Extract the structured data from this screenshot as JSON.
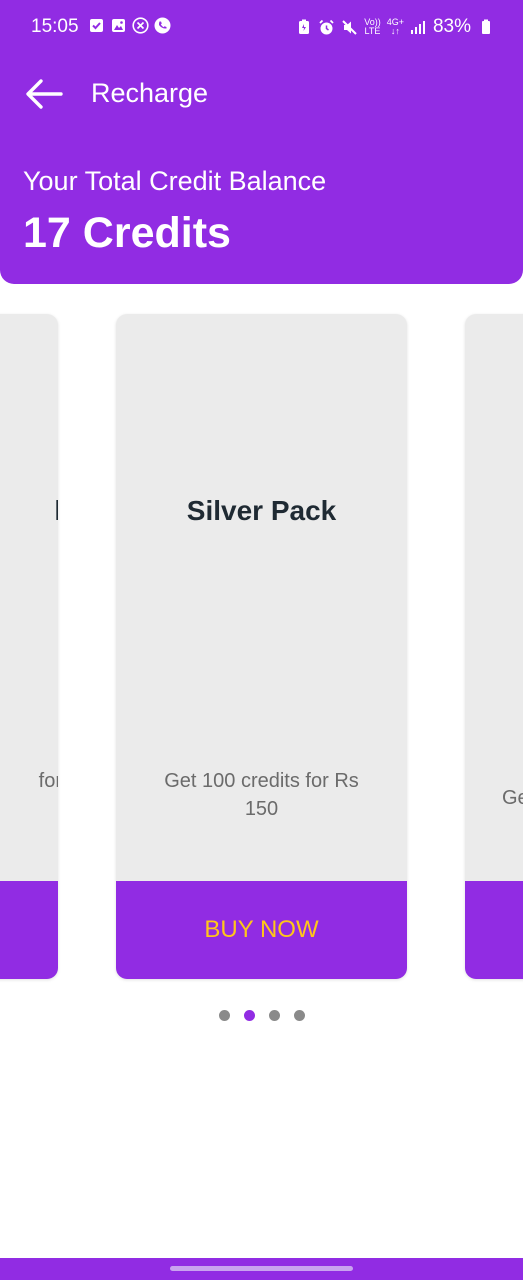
{
  "status_bar": {
    "time": "15:05",
    "battery": "83%",
    "network_top": "Vo))",
    "network_bottom": "LTE",
    "signal_top": "4G+",
    "left_icons": [
      "check-box-icon",
      "image-icon",
      "close-circle-icon",
      "phone-circle-icon"
    ],
    "right_icons": [
      "battery-saver-icon",
      "alarm-icon",
      "mute-icon",
      "signal-icon",
      "battery-icon"
    ]
  },
  "app_bar": {
    "title": "Recharge",
    "back_icon": "arrow-left-icon"
  },
  "balance": {
    "label": "Your Total Credit Balance",
    "value": "17 Credits"
  },
  "carousel": {
    "cards": [
      {
        "title": "k",
        "description": "for",
        "button": ""
      },
      {
        "title": "Silver Pack",
        "description": "Get 100 credits for Rs 150",
        "button": "BUY NOW"
      },
      {
        "title": "",
        "description": "Ge",
        "button": ""
      }
    ],
    "dots": {
      "count": 4,
      "active_index": 1
    }
  },
  "colors": {
    "primary": "#912ce3",
    "button_text": "#ffc61a",
    "card_bg": "#ebebeb",
    "card_title": "#1f2a33",
    "card_desc": "#6b6b6b"
  }
}
